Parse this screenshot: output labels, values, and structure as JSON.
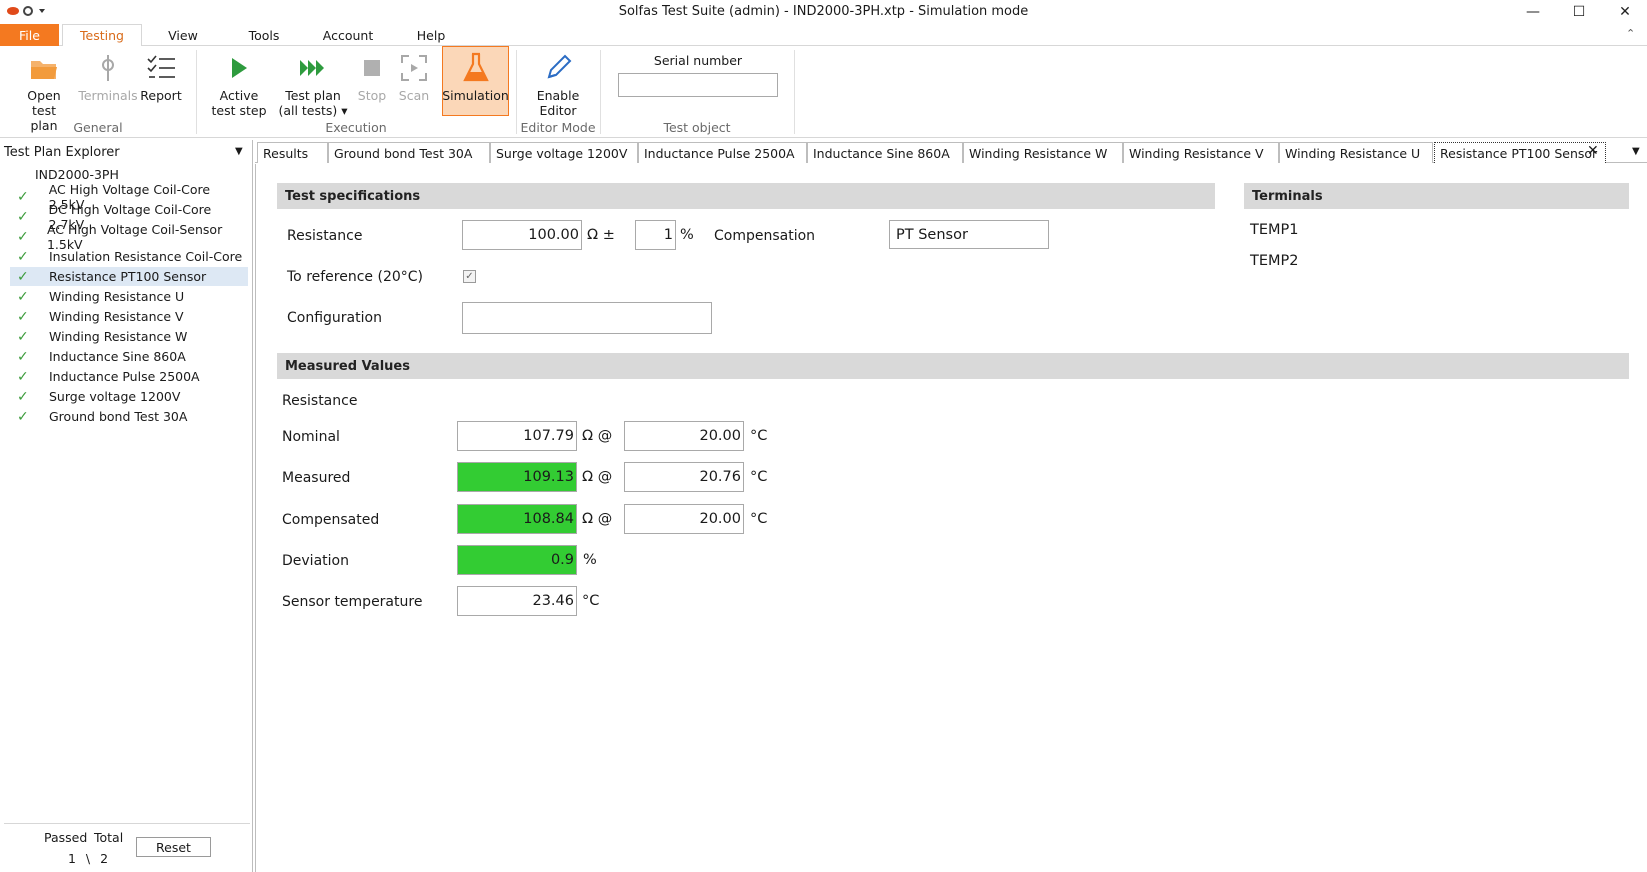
{
  "window": {
    "title": "Solfas Test Suite (admin)  - IND2000-3PH.xtp - Simulation mode",
    "minimize": "—",
    "maximize": "☐",
    "close": "✕"
  },
  "menu": [
    "File",
    "Testing",
    "View",
    "Tools",
    "Account",
    "Help"
  ],
  "ribbon": {
    "groups": {
      "general": "General",
      "execution": "Execution",
      "editor_mode": "Editor Mode",
      "test_object": "Test object"
    },
    "buttons": {
      "open_test_plan": [
        "Open test",
        "plan"
      ],
      "terminals": "Terminals",
      "report": "Report",
      "active_test_step": [
        "Active",
        "test step"
      ],
      "test_plan_all": [
        "Test plan",
        "(all tests) ▾"
      ],
      "stop": "Stop",
      "scan": "Scan",
      "simulation": "Simulation",
      "enable_editor": [
        "Enable",
        "Editor"
      ]
    },
    "serial_number_label": "Serial number",
    "serial_number_value": ""
  },
  "explorer": {
    "title": "Test Plan Explorer",
    "root": "IND2000-3PH",
    "items": [
      {
        "label": "AC High Voltage Coil-Core 2.5kV",
        "passed": true
      },
      {
        "label": "DC High Voltage Coil-Core 2.7kV",
        "passed": true
      },
      {
        "label": "AC High Voltage Coil-Sensor 1.5kV",
        "passed": true
      },
      {
        "label": "Insulation Resistance Coil-Core",
        "passed": true
      },
      {
        "label": "Resistance PT100 Sensor",
        "passed": true,
        "selected": true
      },
      {
        "label": "Winding Resistance U",
        "passed": true
      },
      {
        "label": "Winding Resistance  V",
        "passed": true
      },
      {
        "label": "Winding Resistance  W",
        "passed": true
      },
      {
        "label": "Inductance Sine 860A",
        "passed": true
      },
      {
        "label": "Inductance Pulse 2500A",
        "passed": true
      },
      {
        "label": "Surge voltage 1200V",
        "passed": true
      },
      {
        "label": "Ground bond Test 30A",
        "passed": true
      }
    ],
    "passed_label": "Passed",
    "total_label": "Total",
    "stats_value": "1 \\ 2",
    "reset_label": "Reset"
  },
  "tabs": [
    "Results",
    "Ground bond Test 30A",
    "Surge voltage 1200V",
    "Inductance Pulse 2500A",
    "Inductance Sine 860A",
    "Winding Resistance  W",
    "Winding Resistance  V",
    "Winding Resistance U",
    "Resistance PT100 Sensor"
  ],
  "spec": {
    "header": "Test specifications",
    "resistance_label": "Resistance",
    "resistance_value": "100.00",
    "resistance_unit": "Ω  ±",
    "tolerance_value": "1",
    "tolerance_unit": "%",
    "compensation_label": "Compensation",
    "compensation_value": "PT Sensor",
    "to_reference_label": "To reference   (20°C)",
    "to_reference_checked": true,
    "configuration_label": "Configuration",
    "configuration_value": ""
  },
  "terminals": {
    "header": "Terminals",
    "items": [
      "TEMP1",
      "TEMP2"
    ]
  },
  "measured": {
    "header": "Measured Values",
    "section_label": "Resistance",
    "ohm_at": "Ω   @",
    "deg": "°C",
    "percent": "%",
    "nominal": {
      "label": "Nominal",
      "value": "107.79",
      "temp": "20.00"
    },
    "measured": {
      "label": "Measured",
      "value": "109.13",
      "temp": "20.76"
    },
    "compensated": {
      "label": "Compensated",
      "value": "108.84",
      "temp": "20.00"
    },
    "deviation": {
      "label": "Deviation",
      "value": "0.9"
    },
    "sensor_temp": {
      "label": "Sensor temperature",
      "value": "23.46"
    }
  },
  "colors": {
    "accent": "#f47920",
    "pass_fill": "#33cc33",
    "pass_check": "#3a9b3a",
    "selection": "#dde8f4"
  }
}
